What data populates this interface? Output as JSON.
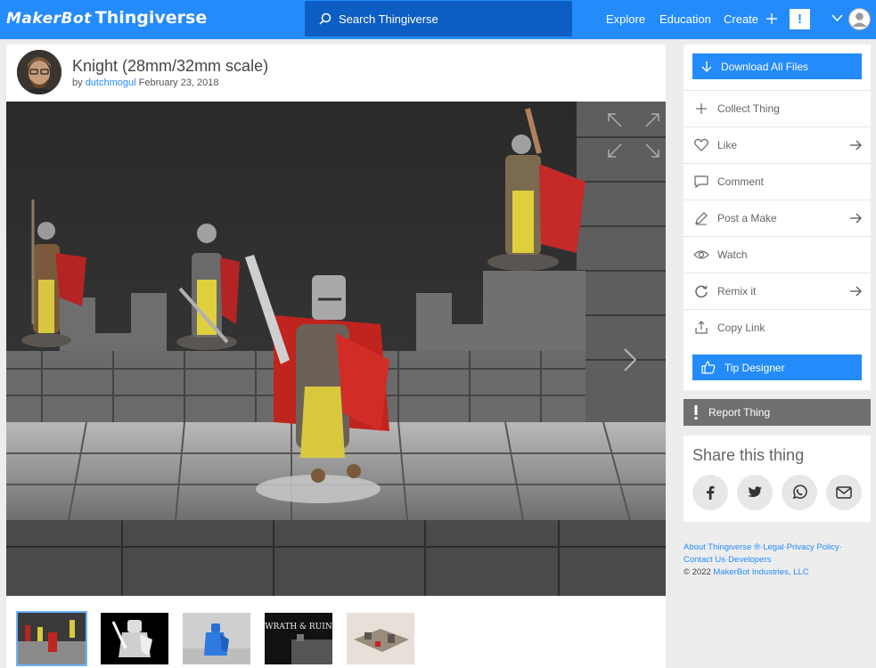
{
  "header": {
    "brand": "MakerBot",
    "product": "Thingiverse",
    "search_placeholder": "Search Thingiverse",
    "nav": {
      "explore": "Explore",
      "education": "Education",
      "create": "Create"
    },
    "alert_glyph": "!"
  },
  "thing": {
    "title": "Knight (28mm/32mm scale)",
    "by": "by",
    "author": "dutchmogul",
    "date": "February 23, 2018"
  },
  "actions": {
    "download": "Download All Files",
    "collect": "Collect Thing",
    "like": "Like",
    "comment": "Comment",
    "post_make": "Post a Make",
    "watch": "Watch",
    "remix": "Remix it",
    "copy_link": "Copy Link",
    "tip": "Tip Designer"
  },
  "report": "Report Thing",
  "share": {
    "title": "Share this thing"
  },
  "footer": {
    "about": "About Thingiverse ®",
    "legal": "Legal",
    "privacy": "Privacy Policy",
    "contact": "Contact Us",
    "developers": "Developers",
    "copyright": "©  2022",
    "company": "MakerBot Industries, LLC"
  },
  "thumbnails": [
    {
      "name": "thumbnail-knights-on-wall"
    },
    {
      "name": "thumbnail-knight-render-bw"
    },
    {
      "name": "thumbnail-blue-print"
    },
    {
      "name": "thumbnail-wrath-ruin",
      "label": "WRATH & RUIN"
    },
    {
      "name": "thumbnail-dungeon-tiles"
    }
  ],
  "colors": {
    "accent": "#248bfb",
    "search_bg": "#0d5ec4",
    "report_bg": "#707070"
  }
}
